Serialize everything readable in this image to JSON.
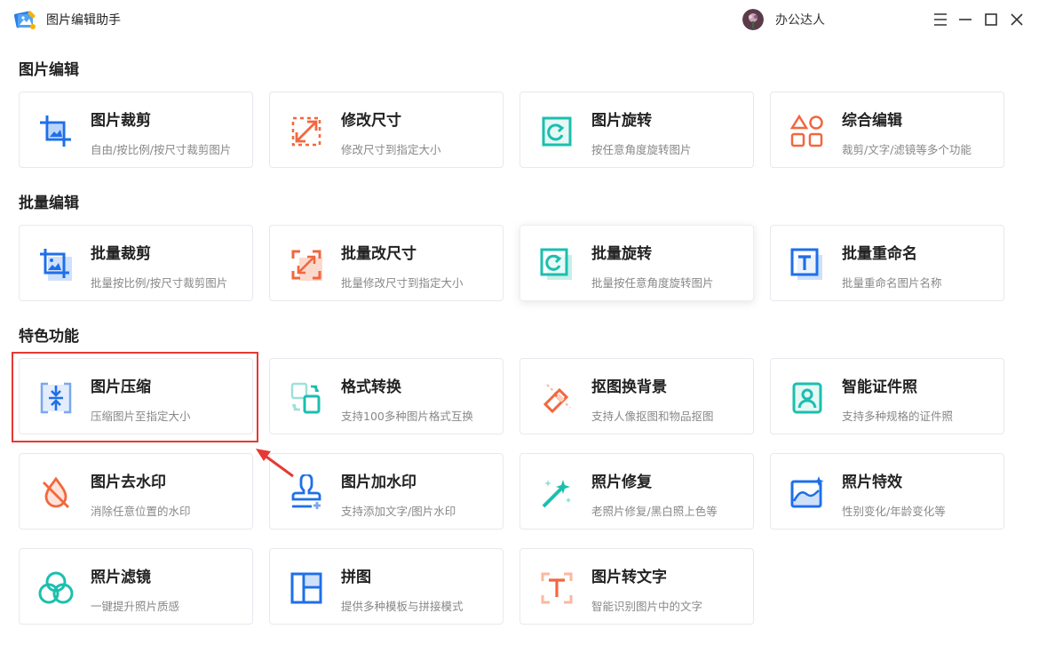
{
  "app": {
    "title": "图片编辑助手",
    "username": "办公达人"
  },
  "window_controls": [
    "menu-icon",
    "minimize-icon",
    "maximize-icon",
    "close-icon"
  ],
  "colors": {
    "blue": "#1e6fe8",
    "orange": "#f2673e",
    "teal": "#1bbfae",
    "highlight": "#e53935"
  },
  "sections": [
    {
      "title": "图片编辑",
      "cards": [
        {
          "title": "图片裁剪",
          "desc": "自由/按比例/按尺寸裁剪图片",
          "icon": "crop-icon"
        },
        {
          "title": "修改尺寸",
          "desc": "修改尺寸到指定大小",
          "icon": "resize-icon"
        },
        {
          "title": "图片旋转",
          "desc": "按任意角度旋转图片",
          "icon": "rotate-icon"
        },
        {
          "title": "综合编辑",
          "desc": "裁剪/文字/滤镜等多个功能",
          "icon": "shapes-icon"
        }
      ]
    },
    {
      "title": "批量编辑",
      "cards": [
        {
          "title": "批量裁剪",
          "desc": "批量按比例/按尺寸裁剪图片",
          "icon": "batch-crop-icon"
        },
        {
          "title": "批量改尺寸",
          "desc": "批量修改尺寸到指定大小",
          "icon": "batch-resize-icon"
        },
        {
          "title": "批量旋转",
          "desc": "批量按任意角度旋转图片",
          "icon": "batch-rotate-icon"
        },
        {
          "title": "批量重命名",
          "desc": "批量重命名图片名称",
          "icon": "batch-rename-icon"
        }
      ]
    },
    {
      "title": "特色功能",
      "cards": [
        {
          "title": "图片压缩",
          "desc": "压缩图片至指定大小",
          "icon": "compress-icon"
        },
        {
          "title": "格式转换",
          "desc": "支持100多种图片格式互换",
          "icon": "convert-icon"
        },
        {
          "title": "抠图换背景",
          "desc": "支持人像抠图和物品抠图",
          "icon": "eraser-icon"
        },
        {
          "title": "智能证件照",
          "desc": "支持多种规格的证件照",
          "icon": "id-photo-icon"
        },
        {
          "title": "图片去水印",
          "desc": "消除任意位置的水印",
          "icon": "remove-watermark-icon"
        },
        {
          "title": "图片加水印",
          "desc": "支持添加文字/图片水印",
          "icon": "add-watermark-icon"
        },
        {
          "title": "照片修复",
          "desc": "老照片修复/黑白照上色等",
          "icon": "magic-wand-icon"
        },
        {
          "title": "照片特效",
          "desc": "性别变化/年龄变化等",
          "icon": "photo-effect-icon"
        },
        {
          "title": "照片滤镜",
          "desc": "一键提升照片质感",
          "icon": "filter-icon"
        },
        {
          "title": "拼图",
          "desc": "提供多种模板与拼接模式",
          "icon": "collage-icon"
        },
        {
          "title": "图片转文字",
          "desc": "智能识别图片中的文字",
          "icon": "ocr-icon"
        }
      ]
    }
  ]
}
